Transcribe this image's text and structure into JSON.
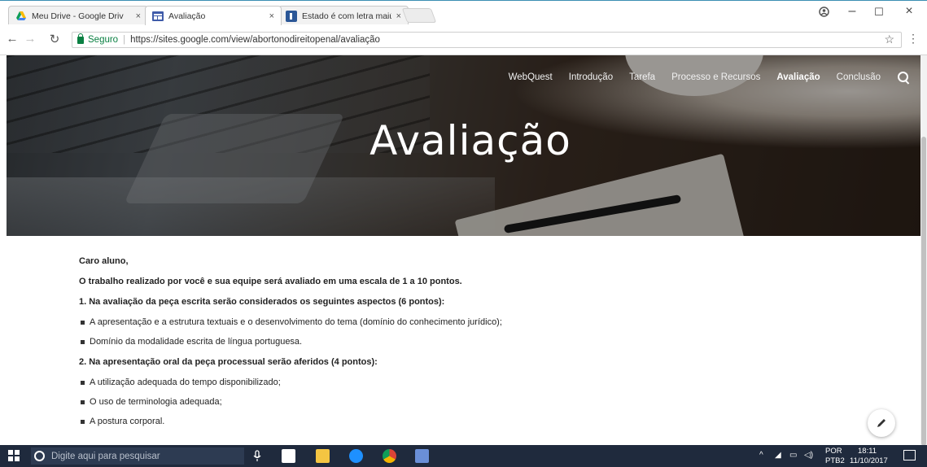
{
  "browser": {
    "tabs": [
      {
        "title": "Meu Drive - Google Driv",
        "active": false,
        "icon": "google-drive-icon"
      },
      {
        "title": "Avaliação",
        "active": true,
        "icon": "google-sites-icon"
      },
      {
        "title": "Estado é com letra maiús",
        "active": false,
        "icon": "blog-icon"
      }
    ],
    "close_glyph": "×",
    "secure_label": "Seguro",
    "separator": "|",
    "url": "https://sites.google.com/view/abortonodireitopenal/avaliação"
  },
  "site": {
    "nav": [
      "WebQuest",
      "Introdução",
      "Tarefa",
      "Processo e Recursos",
      "Avaliação",
      "Conclusão"
    ],
    "active_nav": "Avaliação",
    "hero_title": "Avaliação"
  },
  "content": {
    "greeting": "Caro aluno,",
    "intro": "O trabalho realizado por você e sua equipe será avaliado em uma escala de 1 a 10 pontos.",
    "section1_title": "1. Na avaliação da peça escrita serão considerados os seguintes aspectos (6 pontos):",
    "section1_items": [
      "A apresentação e a estrutura textuais e o desenvolvimento do tema (domínio do conhecimento jurídico);",
      "Domínio da modalidade escrita de língua portuguesa."
    ],
    "section2_title": "2. Na apresentação oral da peça processual serão aferidos (4 pontos):",
    "section2_items": [
      "A utilização adequada do tempo disponibilizado;",
      "O uso de terminologia adequada;",
      "A postura corporal."
    ]
  },
  "taskbar": {
    "search_placeholder": "Digite aqui para pesquisar",
    "lang_top": "POR",
    "lang_bottom": "PTB2",
    "time": "18:11",
    "date": "11/10/2017"
  },
  "colors": {
    "secure_green": "#0b8043",
    "taskbar": "#1f2a3d",
    "accent_blue": "#3b8fb3"
  }
}
